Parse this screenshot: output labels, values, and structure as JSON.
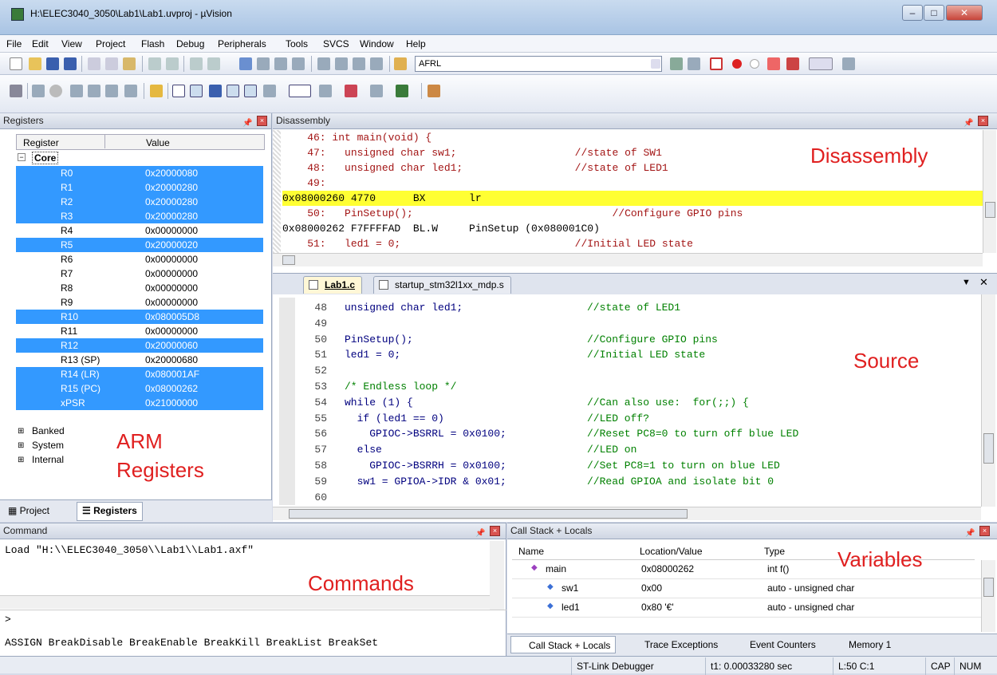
{
  "window": {
    "title": "H:\\ELEC3040_3050\\Lab1\\Lab1.uvproj - µVision"
  },
  "menu": [
    "File",
    "Edit",
    "View",
    "Project",
    "Flash",
    "Debug",
    "Peripherals",
    "Tools",
    "SVCS",
    "Window",
    "Help"
  ],
  "toolbar": {
    "target_combo": "AFRL"
  },
  "registers": {
    "title": "Registers",
    "col_register": "Register",
    "col_value": "Value",
    "core": "Core",
    "rows": [
      {
        "name": "R0",
        "value": "0x20000080",
        "sel": true
      },
      {
        "name": "R1",
        "value": "0x20000280",
        "sel": true
      },
      {
        "name": "R2",
        "value": "0x20000280",
        "sel": true
      },
      {
        "name": "R3",
        "value": "0x20000280",
        "sel": true
      },
      {
        "name": "R4",
        "value": "0x00000000",
        "sel": false
      },
      {
        "name": "R5",
        "value": "0x20000020",
        "sel": true
      },
      {
        "name": "R6",
        "value": "0x00000000",
        "sel": false
      },
      {
        "name": "R7",
        "value": "0x00000000",
        "sel": false
      },
      {
        "name": "R8",
        "value": "0x00000000",
        "sel": false
      },
      {
        "name": "R9",
        "value": "0x00000000",
        "sel": false
      },
      {
        "name": "R10",
        "value": "0x080005D8",
        "sel": true
      },
      {
        "name": "R11",
        "value": "0x00000000",
        "sel": false
      },
      {
        "name": "R12",
        "value": "0x20000060",
        "sel": true
      },
      {
        "name": "R13 (SP)",
        "value": "0x20000680",
        "sel": false
      },
      {
        "name": "R14 (LR)",
        "value": "0x080001AF",
        "sel": true
      },
      {
        "name": "R15 (PC)",
        "value": "0x08000262",
        "sel": true
      },
      {
        "name": "xPSR",
        "value": "0x21000000",
        "sel": true
      }
    ],
    "groups": [
      "Banked",
      "System",
      "Internal"
    ],
    "tab_project": "Project",
    "tab_registers": "Registers"
  },
  "disassembly": {
    "title": "Disassembly",
    "lines": [
      "    46: int main(void) {",
      "    47:   unsigned char sw1;                   //state of SW1",
      "    48:   unsigned char led1;                  //state of LED1",
      "    49: ",
      "0x08000260 4770      BX       lr",
      "    50:   PinSetup();                                //Configure GPIO pins",
      "0x08000262 F7FFFFAD  BL.W     PinSetup (0x080001C0)",
      "    51:   led1 = 0;                            //Initial LED state"
    ]
  },
  "source": {
    "tab1": "Lab1.c",
    "tab2": "startup_stm32l1xx_mdp.s",
    "lines": [
      {
        "n": "48",
        "code": "unsigned char led1;",
        "comment": "//state of LED1"
      },
      {
        "n": "49",
        "code": "",
        "comment": ""
      },
      {
        "n": "50",
        "code": "PinSetup();",
        "comment": "//Configure GPIO pins"
      },
      {
        "n": "51",
        "code": "led1 = 0;",
        "comment": "//Initial LED state"
      },
      {
        "n": "52",
        "code": "",
        "comment": ""
      },
      {
        "n": "53",
        "code": "/* Endless loop */",
        "comment": ""
      },
      {
        "n": "54",
        "code": "while (1) {",
        "comment": "//Can also use:  for(;;) {"
      },
      {
        "n": "55",
        "code": "  if (led1 == 0)",
        "comment": "//LED off?"
      },
      {
        "n": "56",
        "code": "    GPIOC->BSRRL = 0x0100;",
        "comment": "//Reset PC8=0 to turn off blue LED"
      },
      {
        "n": "57",
        "code": "  else",
        "comment": "//LED on"
      },
      {
        "n": "58",
        "code": "    GPIOC->BSRRH = 0x0100;",
        "comment": "//Set PC8=1 to turn on blue LED"
      },
      {
        "n": "59",
        "code": "  sw1 = GPIOA->IDR & 0x01;",
        "comment": "//Read GPIOA and isolate bit 0"
      },
      {
        "n": "60",
        "code": "",
        "comment": ""
      }
    ]
  },
  "command": {
    "title": "Command",
    "output": "Load \"H:\\\\ELEC3040_3050\\\\Lab1\\\\Lab1.axf\"",
    "prompt": ">",
    "hints": "ASSIGN BreakDisable BreakEnable BreakKill BreakList BreakSet"
  },
  "callstack": {
    "title": "Call Stack + Locals",
    "col_name": "Name",
    "col_location": "Location/Value",
    "col_type": "Type",
    "rows": [
      {
        "name": "main",
        "loc": "0x08000262",
        "type": "int f()"
      },
      {
        "name": "sw1",
        "loc": "0x00",
        "type": "auto - unsigned char"
      },
      {
        "name": "led1",
        "loc": "0x80 '€'",
        "type": "auto - unsigned char"
      }
    ],
    "tabs": [
      "Call Stack + Locals",
      "Trace Exceptions",
      "Event Counters",
      "Memory 1"
    ]
  },
  "status": {
    "debugger": "ST-Link Debugger",
    "time": "t1: 0.00033280 sec",
    "pos": "L:50 C:1",
    "caps": "CAP",
    "num": "NUM"
  },
  "annotations": {
    "disassembly": "Disassembly",
    "source": "Source",
    "arm1": "ARM",
    "arm2": "Registers",
    "commands": "Commands",
    "variables": "Variables"
  }
}
